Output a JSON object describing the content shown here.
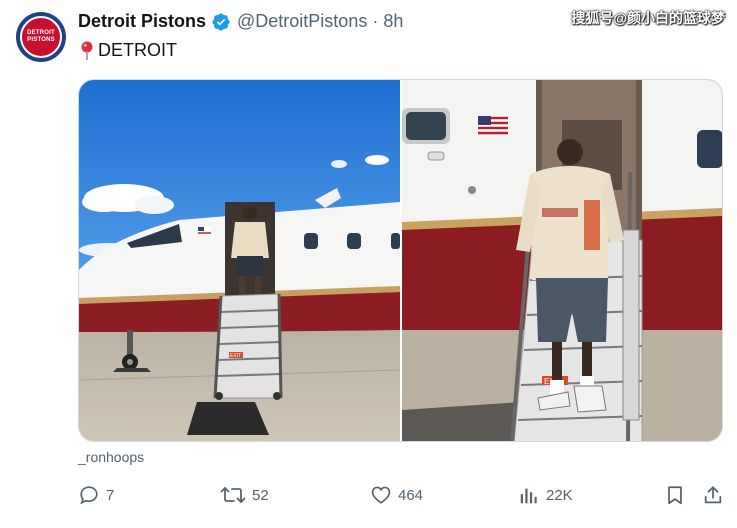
{
  "account": {
    "name": "Detroit Pistons",
    "handle": "@DetroitPistons",
    "separator": "·",
    "time": "8h",
    "avatar_top": "DETROIT",
    "avatar_bottom": "PISTONS"
  },
  "tweet": {
    "location": "DETROIT"
  },
  "watermark": "搜狐号@颜小白的篮球梦",
  "media": {
    "credit": "_ronhoops",
    "stair_sign": "EXIT"
  },
  "actions": {
    "replies": "7",
    "reposts": "52",
    "likes": "464",
    "views": "22K"
  },
  "colors": {
    "brand_blue": "#1d428a",
    "brand_red": "#c8102e",
    "verified": "#1d9bf0",
    "muted": "#536471"
  }
}
